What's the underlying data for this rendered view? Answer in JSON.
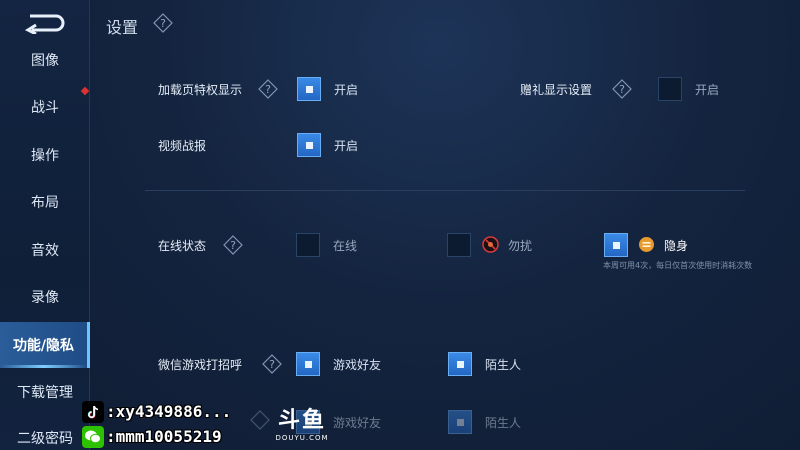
{
  "sidebar": {
    "items": [
      {
        "label": "图像"
      },
      {
        "label": "战斗"
      },
      {
        "label": "操作"
      },
      {
        "label": "布局"
      },
      {
        "label": "音效"
      },
      {
        "label": "录像"
      },
      {
        "label": "功能/隐私",
        "active": true
      },
      {
        "label": "下载管理"
      },
      {
        "label": "二级密码"
      }
    ]
  },
  "header": {
    "title": "设置",
    "help": "?"
  },
  "settings": {
    "loading_privilege": {
      "label": "加载页特权显示",
      "option": "开启",
      "checked": true
    },
    "gift_display": {
      "label": "赠礼显示设置",
      "option": "开启",
      "checked": false
    },
    "video_report": {
      "label": "视频战报",
      "option": "开启",
      "checked": true
    },
    "online_status": {
      "label": "在线状态",
      "options": [
        {
          "label": "在线",
          "checked": false,
          "icon": "none"
        },
        {
          "label": "勿扰",
          "checked": false,
          "icon": "do-not-disturb-icon"
        },
        {
          "label": "隐身",
          "checked": true,
          "icon": "invisible-icon"
        }
      ],
      "note": "本周可用4次，每日仅首次使用时消耗次数"
    },
    "wechat_greeting": {
      "label": "微信游戏打招呼",
      "options": [
        {
          "label": "游戏好友",
          "checked": true
        },
        {
          "label": "陌生人",
          "checked": true
        }
      ]
    },
    "next_row": {
      "options": [
        {
          "label": "游戏好友"
        },
        {
          "label": "陌生人"
        }
      ]
    }
  },
  "overlay": {
    "tiktok_id": ":xy4349886...",
    "wechat_id": ":mmm10055219",
    "douyu_logo": "斗鱼",
    "douyu_url": "DOUYU.COM"
  },
  "colors": {
    "accent": "#2f7bd8",
    "checkbox_on": "#3a8ae6",
    "active_nav": "#2a5d99",
    "alert": "#e0302f"
  }
}
